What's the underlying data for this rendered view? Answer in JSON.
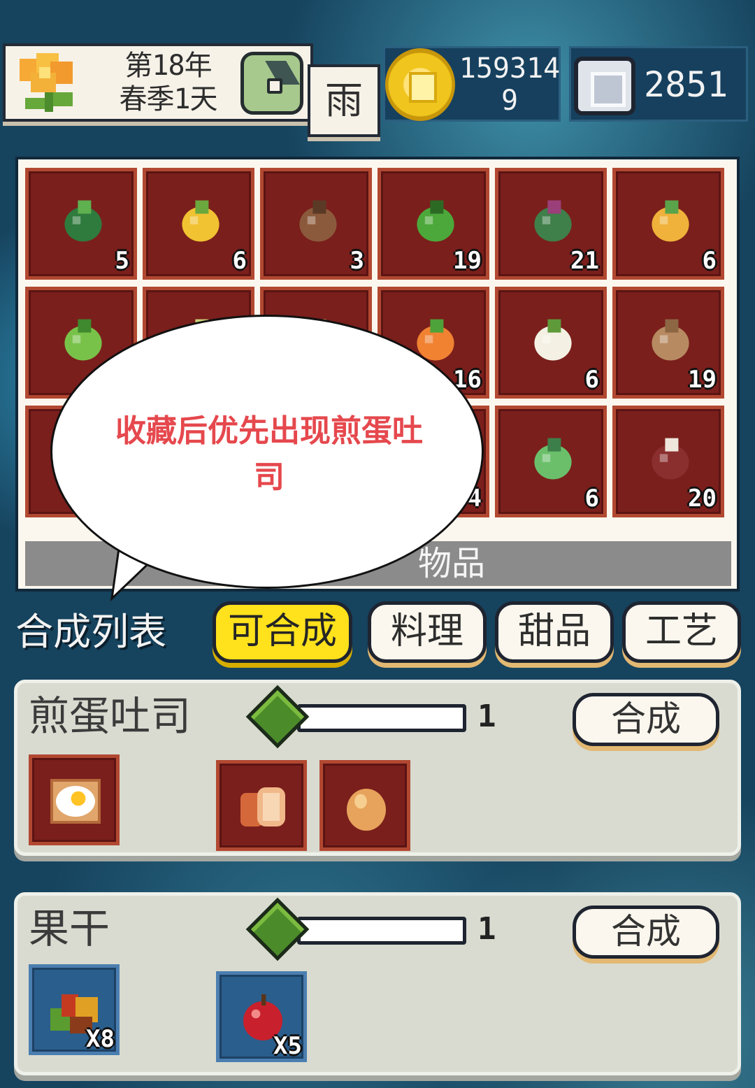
{
  "top_bar": {
    "date_line1": "第18年",
    "date_line2": "春季1天",
    "weather": "雨",
    "coins_line1": "159314",
    "coins_line2": "9",
    "gems": "2851"
  },
  "inventory": {
    "label": "物品",
    "items": [
      {
        "icon": "cabbage-icon",
        "count": "5"
      },
      {
        "icon": "corn-icon",
        "count": "6"
      },
      {
        "icon": "ginseng-root-icon",
        "count": "3"
      },
      {
        "icon": "green-pepper-icon",
        "count": "19"
      },
      {
        "icon": "eggplant-icon",
        "count": "21"
      },
      {
        "icon": "pineapple-icon",
        "count": "6"
      },
      {
        "icon": "leafy-greens-icon",
        "count": ""
      },
      {
        "icon": "vegetable-icon",
        "count": ""
      },
      {
        "icon": "vegetable-icon",
        "count": ""
      },
      {
        "icon": "carrot-icon",
        "count": "16"
      },
      {
        "icon": "white-flower-icon",
        "count": "6"
      },
      {
        "icon": "ginger-icon",
        "count": "19"
      },
      {
        "icon": "vegetable-icon",
        "count": ""
      },
      {
        "icon": "vegetable-icon",
        "count": ""
      },
      {
        "icon": "vegetable-icon",
        "count": ""
      },
      {
        "icon": "vegetable-icon",
        "count": "4"
      },
      {
        "icon": "leek-icon",
        "count": "6"
      },
      {
        "icon": "mushroom-icon",
        "count": "20"
      }
    ]
  },
  "bubble": {
    "text": "收藏后优先出现煎蛋吐司"
  },
  "craft": {
    "title": "合成列表",
    "tabs": [
      "可合成",
      "料理",
      "甜品",
      "工艺"
    ],
    "active_tab": 0,
    "recipes": [
      {
        "name": "煎蛋吐司",
        "count": "1",
        "button": "合成",
        "result_icon": "fried-egg-toast-icon",
        "ingredients": [
          {
            "icon": "bread-icon",
            "qty": ""
          },
          {
            "icon": "egg-icon",
            "qty": ""
          }
        ]
      },
      {
        "name": "果干",
        "count": "1",
        "button": "合成",
        "result_icon": "dried-fruit-icon",
        "ingredients": [
          {
            "icon": "apple-icon",
            "qty": "X5"
          }
        ],
        "result_qty": "X8"
      }
    ]
  },
  "colors": {
    "slot_red": "#7a1f1c",
    "slot_blue": "#2a5e8c",
    "active_tab": "#ffe21c",
    "bubble_text": "#e5484d",
    "background": "#16435e"
  }
}
